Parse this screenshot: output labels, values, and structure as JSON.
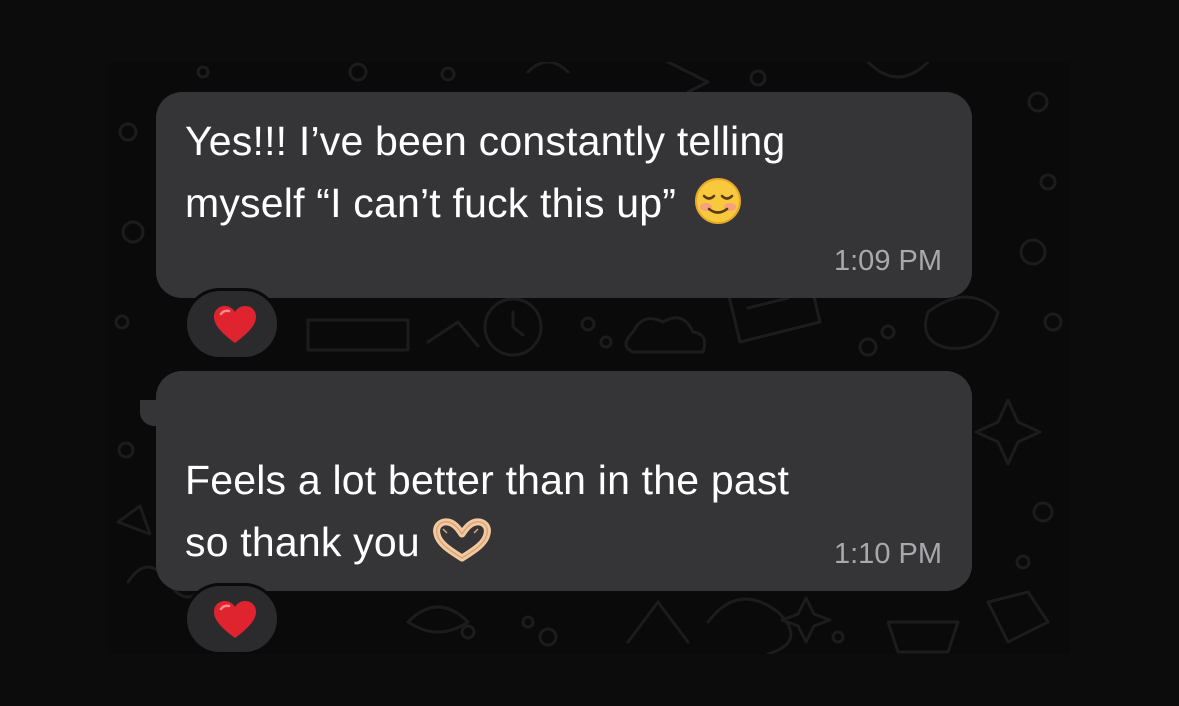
{
  "messages": [
    {
      "line1": "Yes!!! I’ve been constantly telling",
      "line2": "myself “I can’t fuck this up”",
      "emoji": "smiling-face-icon",
      "time": "1:09 PM",
      "reaction": "red-heart-icon"
    },
    {
      "line1": "Feels a lot better than in the past",
      "line2": "so thank you",
      "emoji": "heart-hands-icon",
      "time": "1:10 PM",
      "reaction": "red-heart-icon"
    }
  ],
  "colors": {
    "bubble": "#353538",
    "background": "#0c0c0c",
    "text": "#ffffff",
    "timestamp": "#a9a9ad",
    "heart": "#e0242f"
  }
}
